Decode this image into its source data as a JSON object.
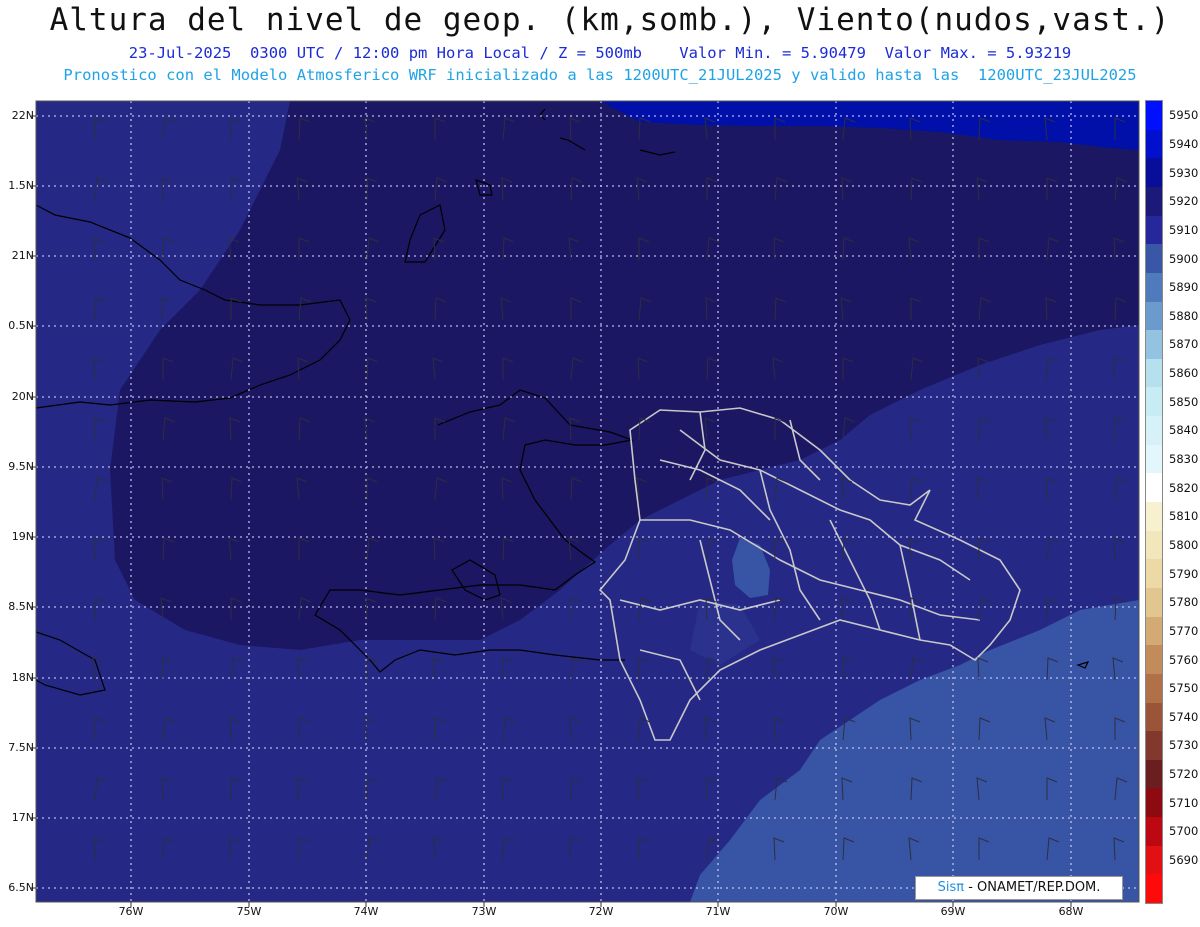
{
  "title": "Altura del nivel de geop. (km,somb.), Viento(nudos,vast.)",
  "subtitle_line1": "23-Jul-2025  0300 UTC / 12:00 pm Hora Local / Z = 500mb    Valor Min. = 5.90479  Valor Max. = 5.93219",
  "subtitle_line2": "Pronostico con el Modelo Atmosferico WRF inicializado a las 1200UTC_21JUL2025 y valido hasta las  1200UTC_23JUL2025",
  "lat_labels": [
    "22N",
    "1.5N",
    "21N",
    "0.5N",
    "20N",
    "9.5N",
    "19N",
    "8.5N",
    "18N",
    "7.5N",
    "17N",
    "6.5N"
  ],
  "lon_labels": [
    "76W",
    "75W",
    "74W",
    "73W",
    "72W",
    "71W",
    "70W",
    "69W",
    "68W"
  ],
  "colorbar": {
    "labels": [
      "5950",
      "5940",
      "5930",
      "5920",
      "5910",
      "5900",
      "5890",
      "5880",
      "5870",
      "5860",
      "5850",
      "5840",
      "5830",
      "5820",
      "5810",
      "5800",
      "5790",
      "5780",
      "5770",
      "5760",
      "5750",
      "5740",
      "5730",
      "5720",
      "5710",
      "5700",
      "5690"
    ],
    "colors": [
      "#0010ff",
      "#0010cc",
      "#080e9a",
      "#1c1a78",
      "#26279a",
      "#3a56a6",
      "#4f7bbc",
      "#6b9bcc",
      "#93c3e0",
      "#b5e0ee",
      "#c8ecf4",
      "#d6f1f8",
      "#e3f6fb",
      "#ffffff",
      "#f7f1cf",
      "#f2e6bc",
      "#ecd9a6",
      "#e2c690",
      "#d3aa73",
      "#c28c5a",
      "#b07048",
      "#9a5438",
      "#82382c",
      "#6a1e20",
      "#8c0a10",
      "#bb0812",
      "#e21012",
      "#ff0a0a"
    ]
  },
  "map_colors": {
    "band_5930": "#0010a8",
    "band_5920": "#1b1762",
    "band_5910": "#252885",
    "band_5900": "#3854a4",
    "coastline": "#000000",
    "provinces": "#c8c8c8"
  },
  "credit": {
    "logo": "Sisπ",
    "text": " - ONAMET/REP.DOM."
  }
}
